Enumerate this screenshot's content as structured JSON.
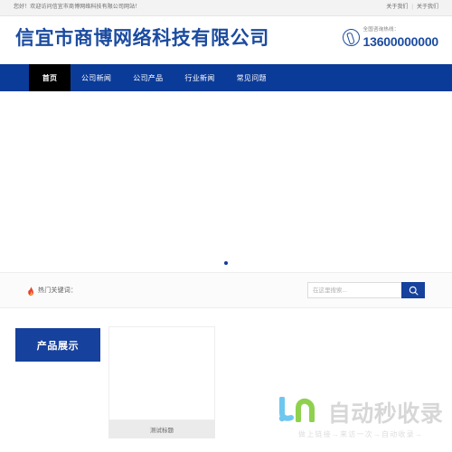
{
  "topbar": {
    "welcome": "您好！欢迎访问信宜市商博网络科技有限公司网站！",
    "separator": "|",
    "links": [
      {
        "label": "关于我们"
      },
      {
        "label": "关于我们"
      }
    ]
  },
  "header": {
    "site_title": "信宜市商博网络科技有限公司",
    "hotline_label": "全国咨询热线：",
    "hotline_number": "13600000000",
    "phone_icon": "phone-icon"
  },
  "nav": {
    "items": [
      {
        "label": "首页",
        "active": true
      },
      {
        "label": "公司新闻",
        "active": false
      },
      {
        "label": "公司产品",
        "active": false
      },
      {
        "label": "行业新闻",
        "active": false
      },
      {
        "label": "常见问题",
        "active": false
      }
    ]
  },
  "banner": {
    "dots": [
      {
        "active": true
      }
    ]
  },
  "keyband": {
    "flame_icon": "flame-icon",
    "keyword_label": "热门关键词：",
    "keywords": [],
    "search": {
      "placeholder": "在这里搜索...",
      "value": "",
      "button_icon": "search-icon"
    }
  },
  "products": {
    "tab_label": "产品展示",
    "cards": [
      {
        "caption": "测试标题"
      }
    ]
  },
  "watermark": {
    "logo_mark": "jn-logo-icon",
    "word": "自动秒收录",
    "tagline": "做上链接→来访一次→自动收录→"
  },
  "colors": {
    "brand_blue": "#0b3b99",
    "deep_blue": "#16419c",
    "title_blue": "#1b4ba0",
    "active_tab": "#000000",
    "band_bg": "#fbfbfb",
    "caption_bg": "#ebebeb",
    "watermark_gray": "#d7d7d7"
  }
}
